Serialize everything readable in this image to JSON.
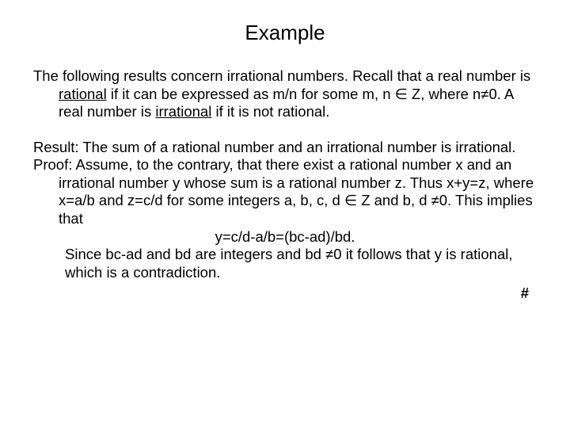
{
  "title": "Example",
  "intro": {
    "pre": "The following results concern irrational numbers. Recall that a real number is ",
    "rational": "rational",
    "mid": " if it can be expressed as m/n for some m, n ∈ Z, where n≠0. A real number is ",
    "irrational": "irrational",
    "post": " if it is not rational."
  },
  "result": "Result: The sum of a rational number and an irrational number is irrational.",
  "proof1": "Proof: Assume, to the contrary, that there exist a rational number x and an irrational number y whose sum is a rational number z. Thus x+y=z, where x=a/b and z=c/d for some integers a, b, c, d ∈ Z and b, d ≠0. This implies that",
  "eq": "y=c/d-a/b=(bc-ad)/bd.",
  "proof2": "Since bc-ad and bd are integers and bd ≠0 it follows that y is rational, which is a contradiction.",
  "hash": "#"
}
